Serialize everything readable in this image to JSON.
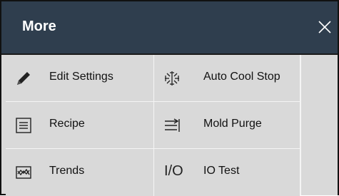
{
  "dialog": {
    "title": "More",
    "close_icon": "close-icon"
  },
  "menu": {
    "items": [
      {
        "label": "Edit Settings",
        "icon": "pencil-icon"
      },
      {
        "label": "Auto Cool Stop",
        "icon": "snowflake-icon"
      },
      {
        "label": "Recipe",
        "icon": "document-list-icon"
      },
      {
        "label": "Mold Purge",
        "icon": "purge-arrows-icon"
      },
      {
        "label": "Trends",
        "icon": "trend-chart-icon"
      },
      {
        "label": "IO Test",
        "icon": "io-icon",
        "icon_text": "I/O"
      }
    ]
  },
  "colors": {
    "header_bg": "#2f3e4e",
    "panel_bg": "#d9d9d9",
    "divider": "#f4f4f4"
  }
}
